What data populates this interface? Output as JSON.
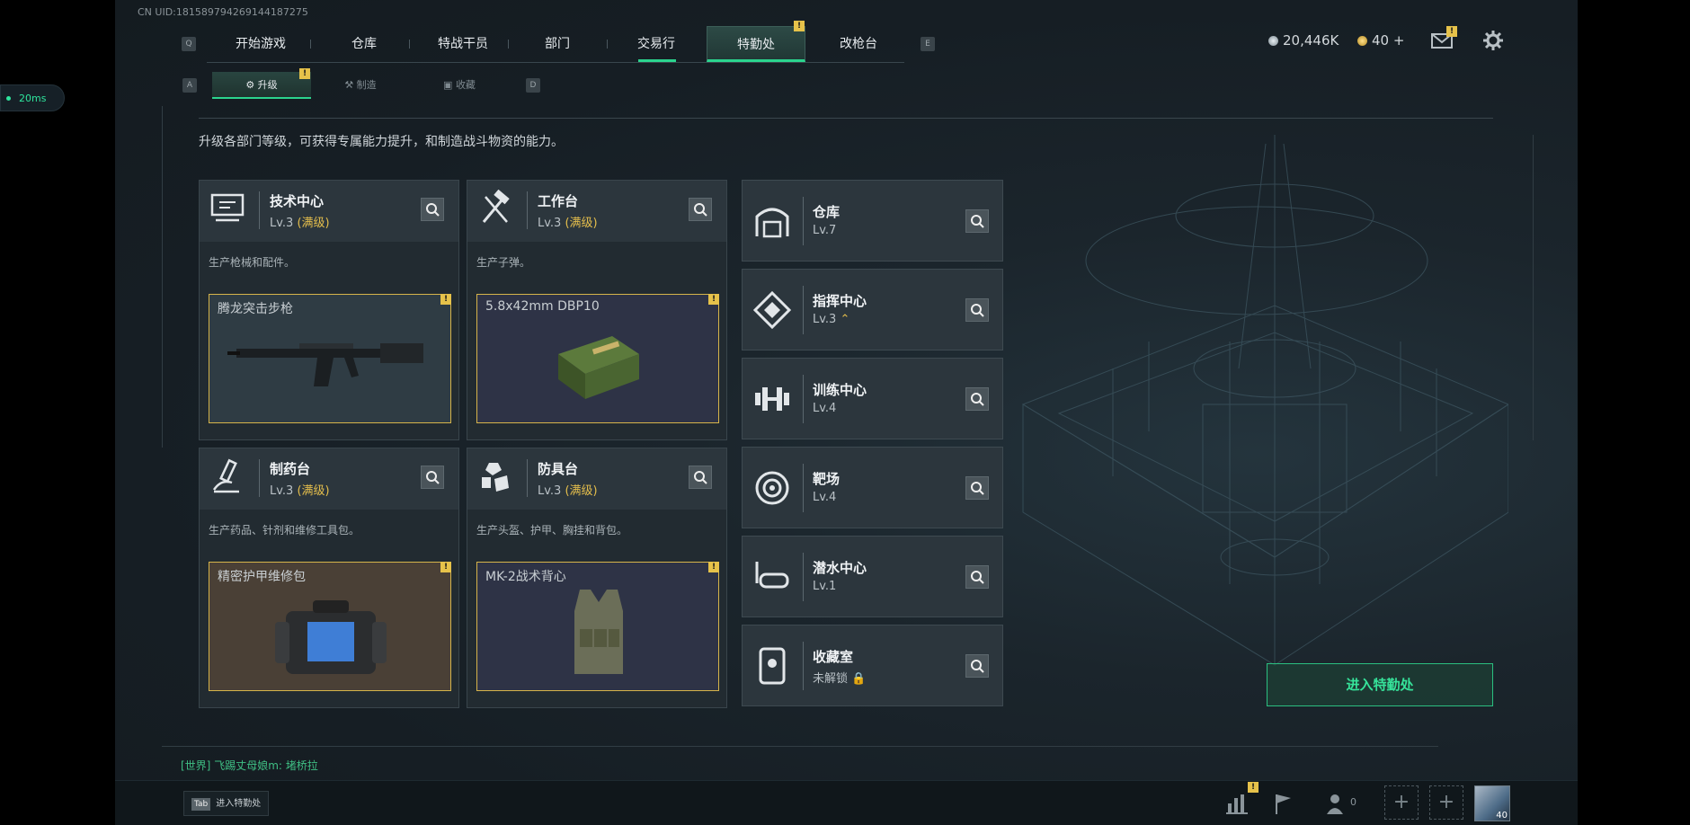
{
  "uid": "CN UID:18158979426914418727​5",
  "ping": "20ms",
  "nav": {
    "left_key": "Q",
    "right_key": "E",
    "tabs": [
      {
        "label": "开始游戏"
      },
      {
        "label": "仓库"
      },
      {
        "label": "特战干员"
      },
      {
        "label": "部门"
      },
      {
        "label": "交易行"
      },
      {
        "label": "特勤处",
        "active": true,
        "badge": "!"
      },
      {
        "label": "改枪台"
      }
    ]
  },
  "subnav": {
    "left_key": "A",
    "right_key": "D",
    "tabs": [
      {
        "label": "升级",
        "active": true,
        "badge": "!"
      },
      {
        "label": "制造"
      },
      {
        "label": "收藏"
      }
    ]
  },
  "currency": {
    "silver": "20,446K",
    "gold": "40 +"
  },
  "mail_badge": "!",
  "description": "升级各部门等级，可获得专属能力提升，和制造战斗物资的能力。",
  "main_cards": [
    {
      "name": "技术中心",
      "level": "Lv.3",
      "level_note": "(满级)",
      "desc": "生产枪械和配件。",
      "item": "腾龙突击步枪",
      "item_badge": "!",
      "icon": "tech-center-icon"
    },
    {
      "name": "工作台",
      "level": "Lv.3",
      "level_note": "(满级)",
      "desc": "生产子弹。",
      "item": "5.8x42mm DBP10",
      "item_badge": "!",
      "icon": "workbench-icon"
    },
    {
      "name": "制药台",
      "level": "Lv.3",
      "level_note": "(满级)",
      "desc": "生产药品、针剂和维修工具包。",
      "item": "精密护甲维修包",
      "item_badge": "!",
      "icon": "pharmacy-icon"
    },
    {
      "name": "防具台",
      "level": "Lv.3",
      "level_note": "(满级)",
      "desc": "生产头盔、护甲、胸挂和背包。",
      "item": "MK-2战术背心",
      "item_badge": "!",
      "icon": "armor-bench-icon"
    }
  ],
  "side_cards": [
    {
      "name": "仓库",
      "level": "Lv.7",
      "icon": "storage-icon"
    },
    {
      "name": "指挥中心",
      "level": "Lv.3",
      "icon": "command-center-icon"
    },
    {
      "name": "训练中心",
      "level": "Lv.4",
      "icon": "training-center-icon"
    },
    {
      "name": "靶场",
      "level": "Lv.4",
      "icon": "shooting-range-icon"
    },
    {
      "name": "潜水中心",
      "level": "Lv.1",
      "icon": "diving-center-icon"
    },
    {
      "name": "收藏室",
      "level": "未解锁",
      "icon": "collection-room-icon"
    }
  ],
  "enter_button": "进入特勤处",
  "chat": {
    "channel": "[世界]",
    "user": "飞踢丈母娘m:",
    "message": "堵桥拉"
  },
  "bottom": {
    "tab_key": "Tab",
    "tab_label": "进入特勤处",
    "stats_badge": "!",
    "friends_count": "0",
    "avatar_level": "40"
  },
  "colors": {
    "accent": "#2bd48e",
    "badge": "#e6c24a",
    "max_level": "#e4be4c"
  }
}
